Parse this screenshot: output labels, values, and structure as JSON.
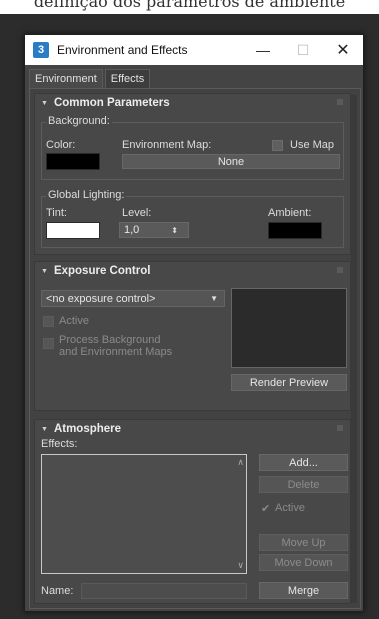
{
  "window": {
    "title": "Environment and Effects",
    "minimize": "—",
    "maximize": "☐",
    "close": "✕"
  },
  "tabs": [
    {
      "label": "Environment",
      "active": true
    },
    {
      "label": "Effects",
      "active": false
    }
  ],
  "common": {
    "header": "Common Parameters",
    "background_label": "Background:",
    "color_label": "Color:",
    "color_value": "#000000",
    "env_map_label": "Environment Map:",
    "use_map_label": "Use Map",
    "env_map_button": "None",
    "global_lighting_label": "Global Lighting:",
    "tint_label": "Tint:",
    "tint_value": "#ffffff",
    "level_label": "Level:",
    "level_value": "1,0",
    "ambient_label": "Ambient:",
    "ambient_value": "#000000"
  },
  "exposure": {
    "header": "Exposure Control",
    "dropdown_value": "<no exposure control>",
    "active_label": "Active",
    "process_label_line1": "Process Background",
    "process_label_line2": "and Environment Maps",
    "render_preview_button": "Render Preview"
  },
  "atmosphere": {
    "header": "Atmosphere",
    "effects_label": "Effects:",
    "add_button": "Add...",
    "delete_button": "Delete",
    "active_label": "Active",
    "move_up_button": "Move Up",
    "move_down_button": "Move Down",
    "name_label": "Name:",
    "merge_button": "Merge"
  },
  "icons": {
    "app": "3ds-max-icon",
    "collapse": "triangle-down-icon",
    "spinner": "updown-arrow-icon"
  },
  "colors": {
    "panel": "#484848",
    "window": "#444444"
  }
}
